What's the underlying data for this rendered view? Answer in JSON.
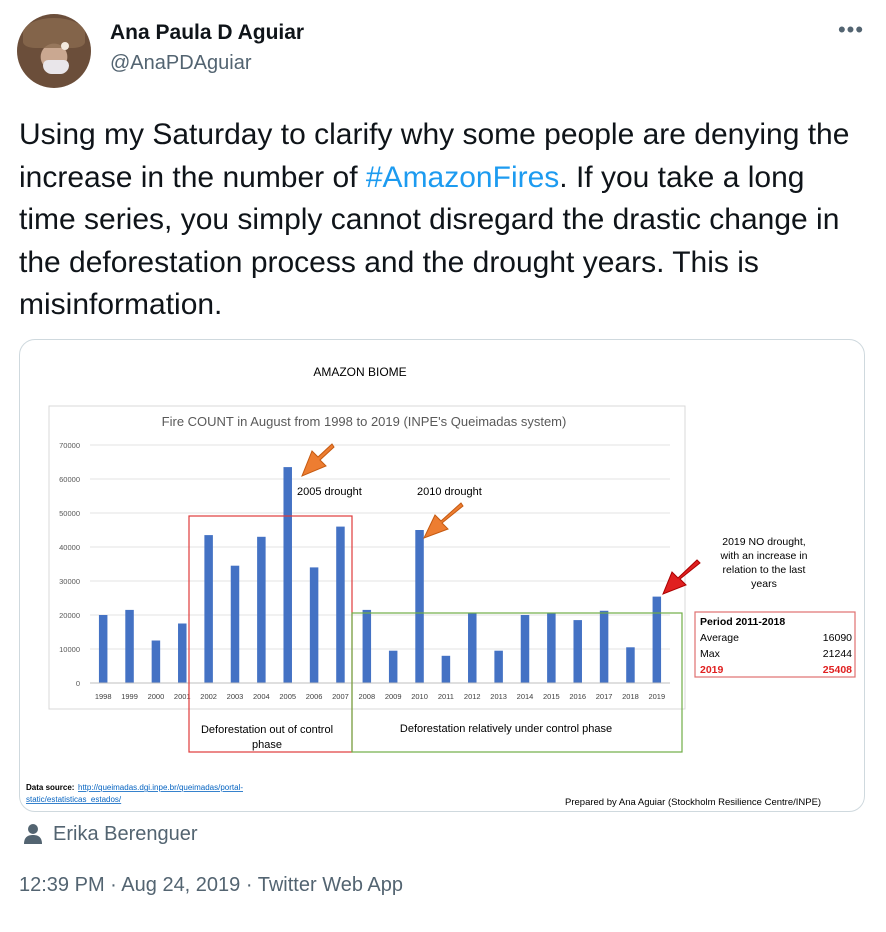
{
  "tweet": {
    "author": {
      "name": "Ana Paula D Aguiar",
      "handle": "@AnaPDAguiar",
      "avatar": "profile photo"
    },
    "more_icon": "more-horizontal-icon",
    "text_before": "Using my Saturday to clarify why some people are denying the increase in the number of ",
    "hashtag": "#AmazonFires",
    "text_after": ". If you take a long time series, you simply cannot disregard the drastic change in the deforestation process and the drought years. This is misinformation.",
    "tagged_user": "Erika Berenguer",
    "time": "12:39 PM",
    "date": "Aug 24, 2019",
    "source": "Twitter Web App",
    "separator": "·",
    "colors": {
      "link": "#1d9bf0",
      "secondary": "#536471",
      "bar": "#4472c4"
    }
  },
  "chart_data": {
    "type": "bar",
    "header": "AMAZON BIOME",
    "title": "Fire COUNT in August from 1998 to 2019 (INPE's Queimadas system)",
    "categories": [
      "1998",
      "1999",
      "2000",
      "2001",
      "2002",
      "2003",
      "2004",
      "2005",
      "2006",
      "2007",
      "2008",
      "2009",
      "2010",
      "2011",
      "2012",
      "2013",
      "2014",
      "2015",
      "2016",
      "2017",
      "2018",
      "2019"
    ],
    "values": [
      20000,
      21500,
      12500,
      17500,
      43500,
      34500,
      43000,
      63500,
      34000,
      46000,
      21500,
      9500,
      45000,
      8000,
      20500,
      9500,
      20000,
      20500,
      18500,
      21244,
      10500,
      25408
    ],
    "yticks": [
      "0",
      "10000",
      "20000",
      "30000",
      "40000",
      "50000",
      "60000",
      "70000"
    ],
    "ylim": [
      0,
      70000
    ],
    "grid": true,
    "annotations": {
      "drought_2005": "2005 drought",
      "drought_2010": "2010 drought",
      "no_drought_2019": [
        "2019 NO drought,",
        "with an increase in",
        "relation to the last",
        "years"
      ]
    },
    "phases": {
      "out_of_control": [
        "Deforestation out of control",
        "phase"
      ],
      "under_control": "Deforestation relatively under control phase"
    },
    "period_box": {
      "title": "Period 2011-2018",
      "rows": [
        {
          "label": "Average",
          "value": "16090"
        },
        {
          "label": "Max",
          "value": "21244"
        },
        {
          "label": "2019",
          "value": "25408"
        }
      ]
    },
    "data_source_label": "Data source:",
    "data_source_url": [
      "http://queimadas.dgi.inpe.br/queimadas/portal-",
      "static/estatisticas_estados/"
    ],
    "credit": "Prepared by Ana Aguiar (Stockholm Resilience Centre/INPE)"
  }
}
